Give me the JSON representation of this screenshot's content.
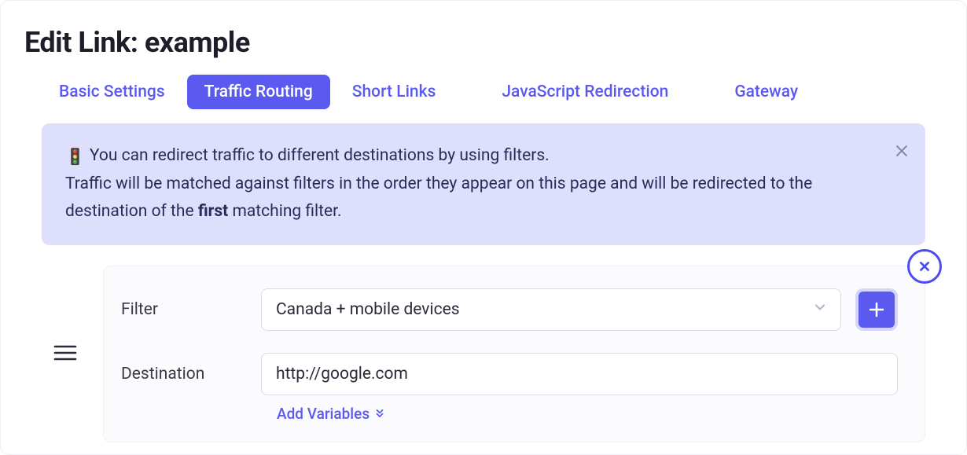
{
  "page": {
    "title": "Edit Link: example"
  },
  "tabs": {
    "items": [
      {
        "label": "Basic Settings",
        "active": false
      },
      {
        "label": "Traffic Routing",
        "active": true
      },
      {
        "label": "Short Links",
        "active": false
      },
      {
        "label": "JavaScript Redirection",
        "active": false
      },
      {
        "label": "Gateway",
        "active": false
      }
    ]
  },
  "alert": {
    "line1": "You can redirect traffic to different destinations by using filters.",
    "line2_a": "Traffic will be matched against filters in the order they appear on this page and will be redirected to the destination of the ",
    "line2_bold": "first",
    "line2_b": " matching filter."
  },
  "filter_block": {
    "filter_label": "Filter",
    "filter_value": "Canada + mobile devices",
    "destination_label": "Destination",
    "destination_value": "http://google.com",
    "add_variables_label": "Add Variables"
  }
}
